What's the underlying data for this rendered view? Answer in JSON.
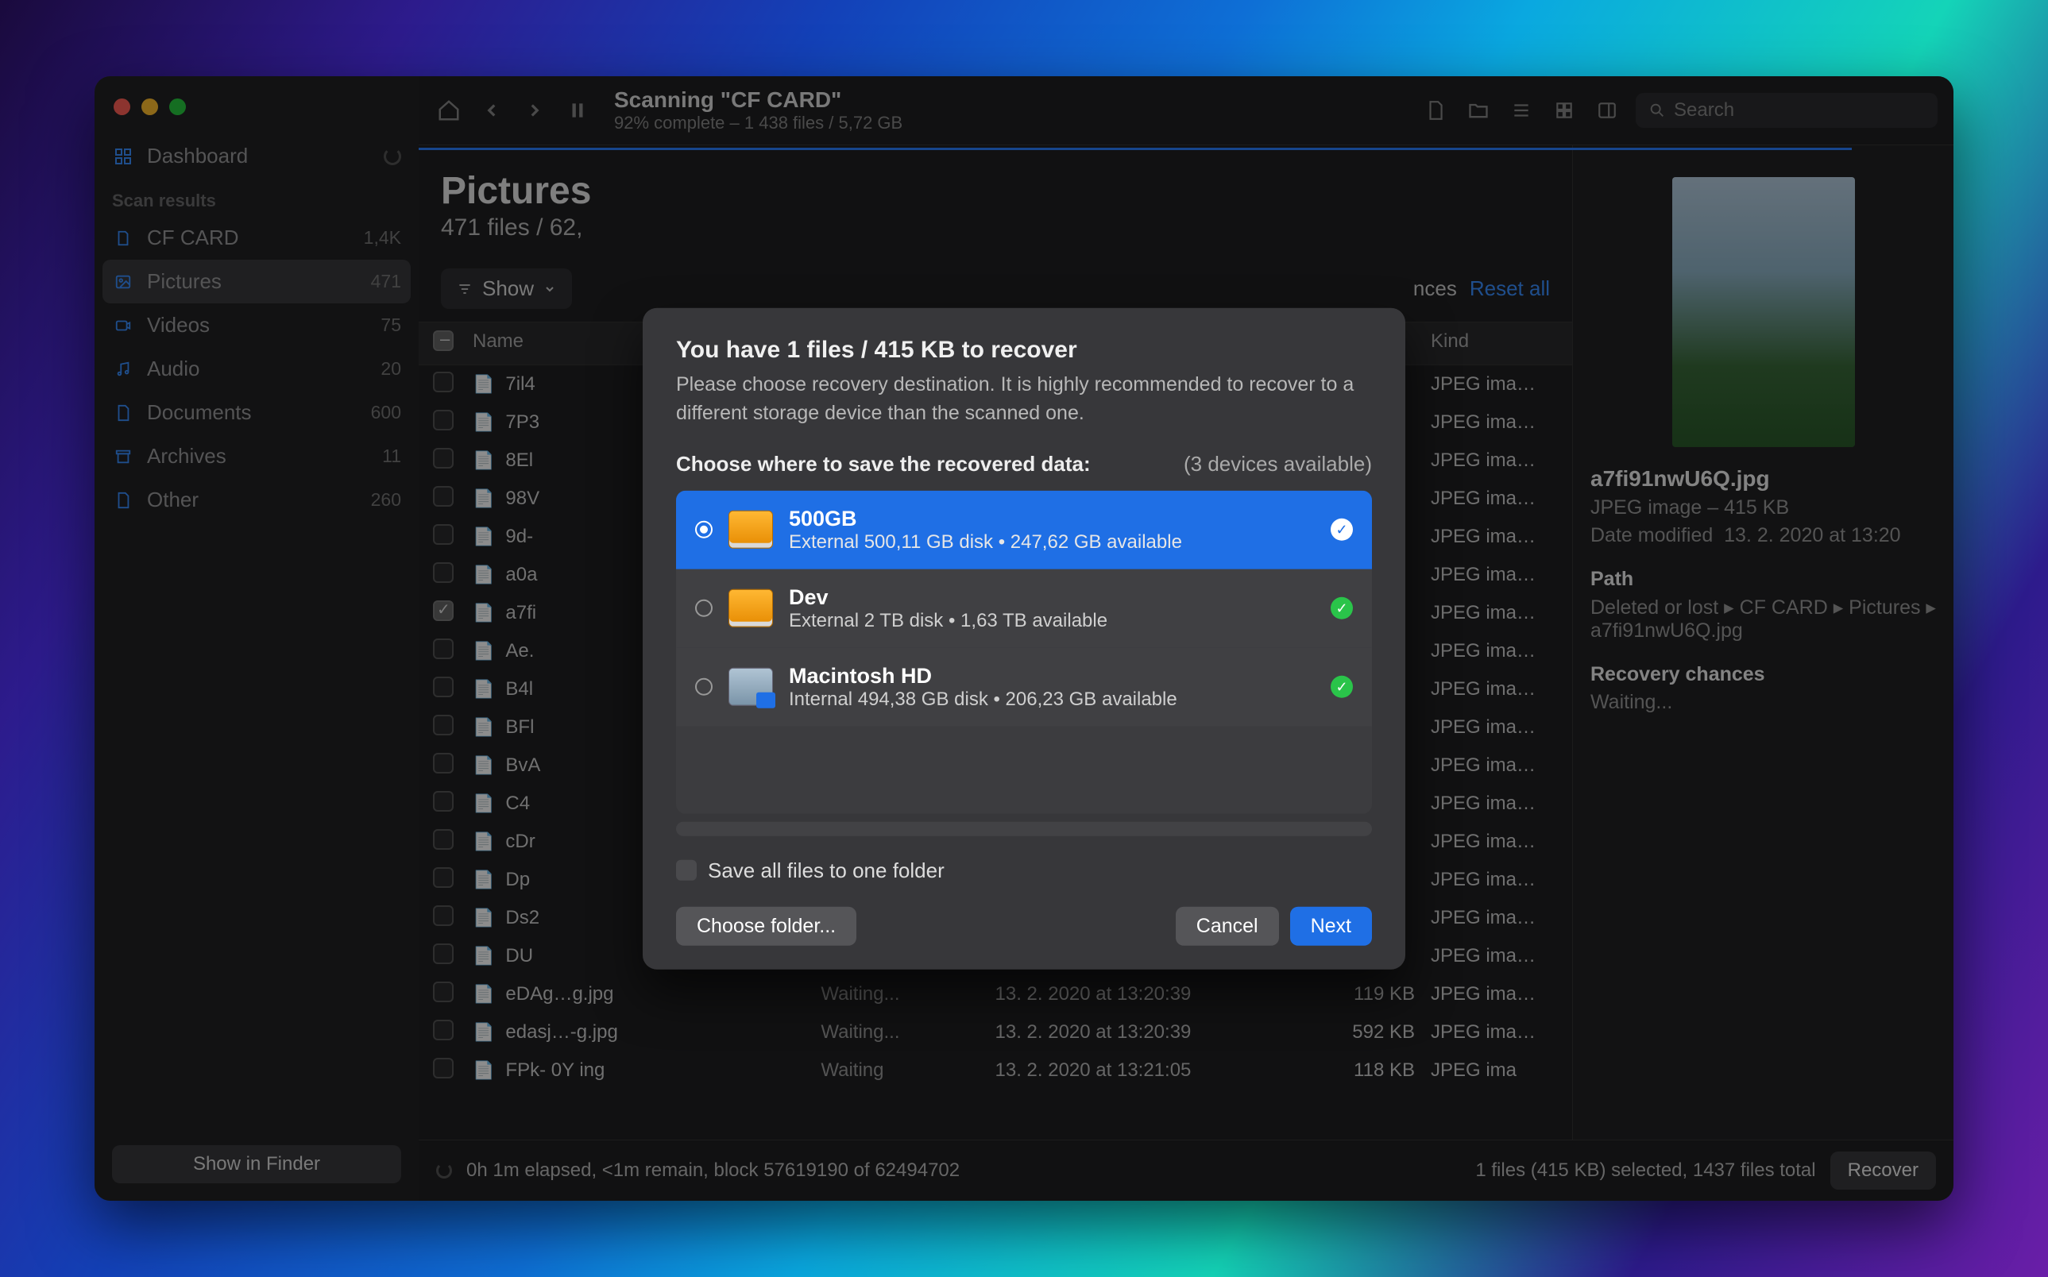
{
  "header": {
    "title": "Scanning \"CF CARD\"",
    "subtitle": "92% complete – 1 438 files / 5,72 GB",
    "search_placeholder": "Search"
  },
  "sidebar": {
    "dashboard": "Dashboard",
    "section": "Scan results",
    "items": [
      {
        "label": "CF CARD",
        "count": "1,4K"
      },
      {
        "label": "Pictures",
        "count": "471"
      },
      {
        "label": "Videos",
        "count": "75"
      },
      {
        "label": "Audio",
        "count": "20"
      },
      {
        "label": "Documents",
        "count": "600"
      },
      {
        "label": "Archives",
        "count": "11"
      },
      {
        "label": "Other",
        "count": "260"
      }
    ],
    "footer_button": "Show in Finder"
  },
  "listpane": {
    "title": "Pictures",
    "subtitle": "471 files / 62,",
    "filter_show": "Show",
    "filter_chances": "nces",
    "reset": "Reset all",
    "columns": {
      "name": "Name",
      "status": "",
      "date": "",
      "size": "",
      "kind": "Kind"
    },
    "rows": [
      {
        "name": "7il4",
        "status": "",
        "date": "",
        "size": "",
        "kind": "JPEG ima…"
      },
      {
        "name": "7P3",
        "status": "",
        "date": "",
        "size": "",
        "kind": "JPEG ima…"
      },
      {
        "name": "8El",
        "status": "",
        "date": "",
        "size": "",
        "kind": "JPEG ima…"
      },
      {
        "name": "98V",
        "status": "",
        "date": "",
        "size": "",
        "kind": "JPEG ima…"
      },
      {
        "name": "9d-",
        "status": "",
        "date": "",
        "size": "",
        "kind": "JPEG ima…"
      },
      {
        "name": "a0a",
        "status": "",
        "date": "",
        "size": "",
        "kind": "JPEG ima…"
      },
      {
        "name": "a7fi",
        "status": "",
        "date": "",
        "size": "",
        "kind": "JPEG ima…",
        "checked": true
      },
      {
        "name": "Ae.",
        "status": "",
        "date": "",
        "size": "",
        "kind": "JPEG ima…"
      },
      {
        "name": "B4l",
        "status": "",
        "date": "",
        "size": "",
        "kind": "JPEG ima…"
      },
      {
        "name": "BFl",
        "status": "",
        "date": "",
        "size": "",
        "kind": "JPEG ima…"
      },
      {
        "name": "BvA",
        "status": "",
        "date": "",
        "size": "",
        "kind": "JPEG ima…"
      },
      {
        "name": "C4",
        "status": "",
        "date": "",
        "size": "",
        "kind": "JPEG ima…"
      },
      {
        "name": "cDr",
        "status": "",
        "date": "",
        "size": "",
        "kind": "JPEG ima…"
      },
      {
        "name": "Dp",
        "status": "",
        "date": "",
        "size": "",
        "kind": "JPEG ima…"
      },
      {
        "name": "Ds2",
        "status": "",
        "date": "",
        "size": "",
        "kind": "JPEG ima…"
      },
      {
        "name": "DU",
        "status": "",
        "date": "",
        "size": "",
        "kind": "JPEG ima…"
      },
      {
        "name": "eDAg…g.jpg",
        "status": "Waiting...",
        "date": "13. 2. 2020 at 13:20:39",
        "size": "119 KB",
        "kind": "JPEG ima…"
      },
      {
        "name": "edasj…-g.jpg",
        "status": "Waiting...",
        "date": "13. 2. 2020 at 13:20:39",
        "size": "592 KB",
        "kind": "JPEG ima…"
      },
      {
        "name": "FPk-  0Y ing",
        "status": "Waiting",
        "date": "13. 2. 2020 at 13:21:05",
        "size": "118 KB",
        "kind": "JPEG ima"
      }
    ]
  },
  "preview": {
    "filename": "a7fi91nwU6Q.jpg",
    "meta": "JPEG image – 415 KB",
    "date_label": "Date modified",
    "date_value": "13. 2. 2020 at 13:20",
    "path_label": "Path",
    "path_value": "Deleted or lost ▸ CF CARD ▸ Pictures ▸ a7fi91nwU6Q.jpg",
    "chances_label": "Recovery chances",
    "chances_value": "Waiting..."
  },
  "statusbar": {
    "left": "0h 1m elapsed, <1m remain, block 57619190 of 62494702",
    "right": "1 files (415 KB) selected, 1437 files total",
    "recover": "Recover"
  },
  "dialog": {
    "title": "You have 1 files / 415 KB to recover",
    "subtitle": "Please choose recovery destination. It is highly recommended to recover to a different storage device than the scanned one.",
    "choose_label": "Choose where to save the recovered data:",
    "devices_available": "(3 devices available)",
    "devices": [
      {
        "name": "500GB",
        "desc": "External 500,11 GB disk • 247,62 GB available",
        "type": "ext",
        "selected": true,
        "badge": "blue"
      },
      {
        "name": "Dev",
        "desc": "External 2 TB disk • 1,63 TB available",
        "type": "ext",
        "selected": false,
        "badge": "green"
      },
      {
        "name": "Macintosh HD",
        "desc": "Internal 494,38 GB disk • 206,23 GB available",
        "type": "int",
        "selected": false,
        "badge": "green"
      }
    ],
    "save_all": "Save all files to one folder",
    "choose_folder": "Choose folder...",
    "cancel": "Cancel",
    "next": "Next"
  }
}
